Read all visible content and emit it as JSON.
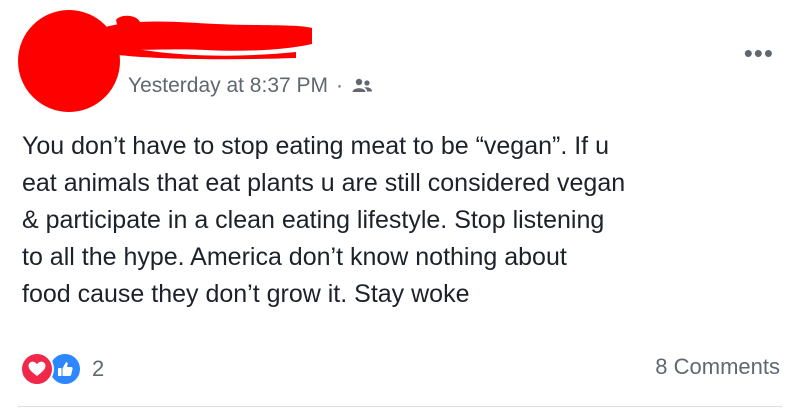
{
  "post": {
    "timestamp": "Yesterday at 8:37 PM",
    "separator": "·",
    "audience_icon": "friends-icon",
    "more_label": "•••",
    "text": "You don’t have to stop eating meat to be “vegan”. If u\neat animals that eat plants u are still considered vegan\n& participate in a clean eating lifestyle. Stop listening\nto all the hype. America don’t know nothing about\nfood cause they don’t grow it. Stay woke",
    "reactions": {
      "icons": [
        "love-reaction-icon",
        "like-reaction-icon"
      ],
      "count": "2"
    },
    "comments_label": "8 Comments"
  },
  "colors": {
    "redaction": "#ff0000",
    "meta_text": "#606770",
    "body_text": "#1d2129",
    "love": "#f0284a",
    "like": "#2d88ff"
  }
}
